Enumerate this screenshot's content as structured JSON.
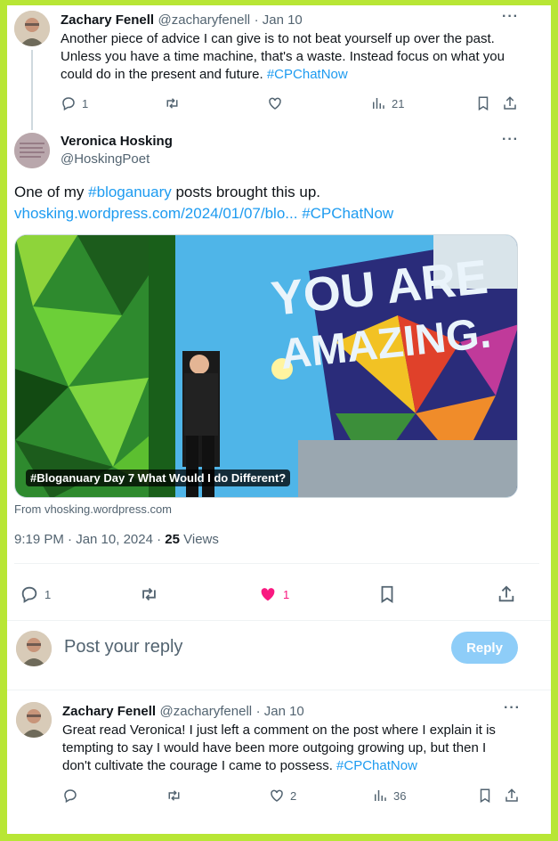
{
  "tweet1": {
    "name": "Zachary Fenell",
    "handle": "@zacharyfenell",
    "date": "· Jan 10",
    "text_line1": "Another piece of advice I can give is to not beat yourself up over the past.",
    "text_line2": "Unless you have a time machine, that's a waste. Instead focus on what you",
    "text_line3": "could do in the present and future.",
    "hashtag": "#CPChatNow",
    "replies": "1",
    "views": "21"
  },
  "tweet2": {
    "name": "Veronica Hosking",
    "handle": "@HoskingPoet",
    "text_prefix": "One of my",
    "hashtag1": "#bloganuary",
    "text_suffix": "posts brought this up.",
    "link": "vhosking.wordpress.com/2024/01/07/blo...",
    "hashtag2": "#CPChatNow",
    "card_title": "#Bloganuary Day 7 What Would I do Different?",
    "card_source": "From vhosking.wordpress.com",
    "timestamp": "9:19 PM · Jan 10, 2024 ·",
    "views_count": "25",
    "views_label": "Views",
    "replies": "1",
    "likes": "1"
  },
  "composer": {
    "placeholder": "Post your reply",
    "button": "Reply"
  },
  "tweet3": {
    "name": "Zachary Fenell",
    "handle": "@zacharyfenell",
    "date": "· Jan 10",
    "text_line1": "Great read Veronica! I just left a comment on the post where I explain it is",
    "text_line2": "tempting to say I would have been more outgoing growing up, but then I",
    "text_line3": "don't cultivate the courage I came to possess.",
    "hashtag": "#CPChatNow",
    "likes": "2",
    "views": "36"
  },
  "colors": {
    "frame": "#b8e635",
    "link": "#1d9bf0",
    "like_active": "#f91880",
    "reply_button": "#8ecdf8"
  },
  "icons": [
    "more-icon",
    "reply-icon",
    "retweet-icon",
    "like-icon",
    "views-icon",
    "bookmark-icon",
    "share-icon"
  ]
}
